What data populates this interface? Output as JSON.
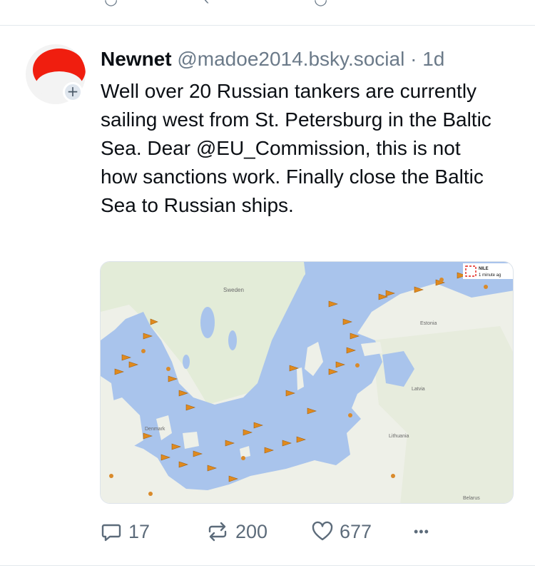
{
  "post": {
    "author_name": "Newnet",
    "handle": "@madoe2014.bsky.social",
    "separator": "·",
    "time": "1d",
    "follow_symbol": "+",
    "text": "Well over 20 Russian tankers are currently sailing west from St. Petersburg in the Baltic Sea. Dear @EU_Commission, this is not how sanctions work. Finally close the Baltic Sea to Russian ships."
  },
  "map": {
    "labels": {
      "sweden": "Sweden",
      "estonia": "Estonia",
      "latvia": "Latvia",
      "lithuania": "Lithuania",
      "denmark": "Denmark",
      "belarus": "Belarus",
      "nile": "NILE",
      "minute": "1 minute ag"
    },
    "colors": {
      "sea": "#a9c4ec",
      "land": "#eef0e8",
      "forest": "#dfe9d5",
      "ship": "#e08a1e"
    }
  },
  "actions": {
    "replies": "17",
    "reposts": "200",
    "likes": "677",
    "more": "•••"
  }
}
